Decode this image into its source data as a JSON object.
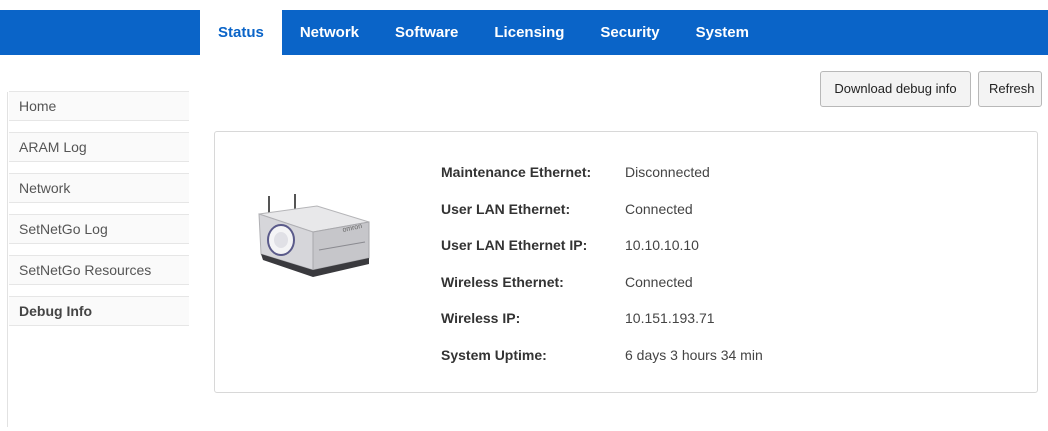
{
  "nav": {
    "tabs": [
      {
        "label": "Status"
      },
      {
        "label": "Network"
      },
      {
        "label": "Software"
      },
      {
        "label": "Licensing"
      },
      {
        "label": "Security"
      },
      {
        "label": "System"
      }
    ],
    "active_tab": "Status"
  },
  "sidebar": {
    "items": [
      {
        "label": "Home"
      },
      {
        "label": "ARAM Log"
      },
      {
        "label": "Network"
      },
      {
        "label": "SetNetGo Log"
      },
      {
        "label": "SetNetGo Resources"
      },
      {
        "label": "Debug Info"
      }
    ],
    "active_item": "Debug Info"
  },
  "toolbar": {
    "download_label": "Download debug info",
    "refresh_label": "Refresh"
  },
  "status": {
    "rows": [
      {
        "label": "Maintenance Ethernet:",
        "value": "Disconnected"
      },
      {
        "label": "User LAN Ethernet:",
        "value": "Connected"
      },
      {
        "label": "User LAN Ethernet IP:",
        "value": "10.10.10.10"
      },
      {
        "label": "Wireless Ethernet:",
        "value": "Connected"
      },
      {
        "label": "Wireless IP:",
        "value": "10.151.193.71"
      },
      {
        "label": "System Uptime:",
        "value": "6 days 3 hours 34 min"
      }
    ]
  },
  "robot": {
    "logo_text": "omron"
  },
  "colors": {
    "brand": "#0a64c8",
    "tab_text": "#ffffff",
    "active_tab_bg": "#ffffff"
  }
}
